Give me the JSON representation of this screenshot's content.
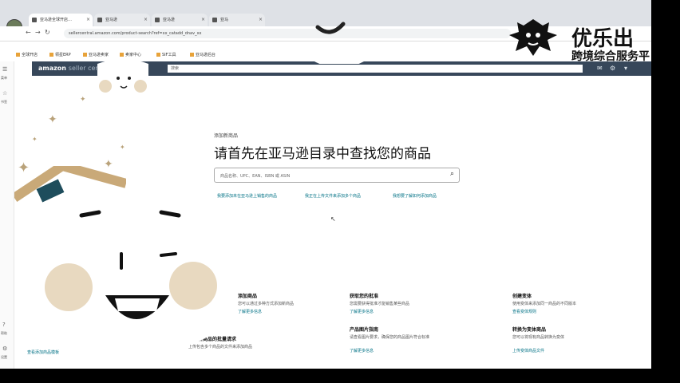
{
  "browser": {
    "tabs": [
      {
        "title": "亚马逊全球开店…"
      },
      {
        "title": "亚马逊"
      },
      {
        "title": "亚马逊"
      },
      {
        "title": "亚马"
      }
    ],
    "url": "sellercentral.amazon.com/product-search?ref=xx_catadd_dnav_xx",
    "bookmarks": [
      "全球开店",
      "领星ERP",
      "亚马逊卖家",
      "卖家中心",
      "SIF工具",
      "亚马逊后台"
    ]
  },
  "amazon_header": {
    "logo_main": "amazon",
    "logo_sub": "seller central",
    "search_placeholder": "搜索"
  },
  "left_rail": {
    "items": [
      {
        "label": "菜单",
        "icon": "menu-icon"
      },
      {
        "label": "书签",
        "icon": "bookmark-icon"
      },
      {
        "label": "帮助",
        "icon": "help-icon"
      },
      {
        "label": "设置",
        "icon": "settings-icon"
      }
    ]
  },
  "main": {
    "overline": "添加新商品",
    "title": "请首先在亚马逊目录中查找您的商品",
    "search_placeholder": "商品名称、UPC、EAN、ISBN 或 ASIN",
    "links": [
      "我要添加未在亚马逊上销售的商品",
      "我正在上传文件来添加多个商品",
      "我想要了解如何添加商品"
    ],
    "sections": [
      {
        "title": "添加商品",
        "text": "您可以通过多种方式添加新商品",
        "link": "了解更多信息"
      },
      {
        "title": "获取您的批准",
        "text": "您需要获得批准才能销售某些商品",
        "link": "了解更多信息"
      },
      {
        "title": "提交新商品的批量请求",
        "text": "上传包含多个商品的文件来添加商品",
        "link": "查看添加商品模板"
      },
      {
        "title": "产品图片指南",
        "text": "请查看图片要求，确保您的商品图片符合标准",
        "link": "了解更多信息"
      },
      {
        "title": "创建变体",
        "text": "使用变体来添加同一商品的不同版本",
        "link": "查看变体规则"
      },
      {
        "title": "转换为变体商品",
        "text": "您可以将现有商品转换为变体",
        "link": "上传变体商品文件"
      }
    ]
  },
  "overlay": {
    "brand_name": "优乐出",
    "brand_subtitle": "跨境综合服务平"
  },
  "colors": {
    "amazon_header": "#37475a",
    "link": "#007185"
  }
}
